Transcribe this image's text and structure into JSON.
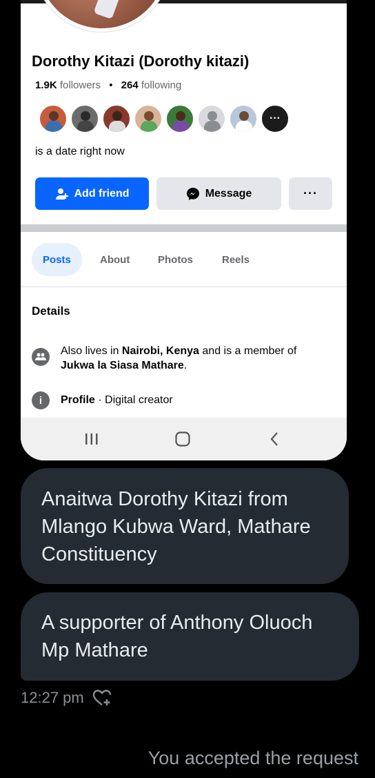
{
  "profile": {
    "name": "Dorothy Kitazi (Dorothy kitazi)",
    "followers_count": "1.9K",
    "followers_label": "followers",
    "following_count": "264",
    "following_label": "following",
    "bio": "is a date right now",
    "more_friends_glyph": "···"
  },
  "actions": {
    "add_friend": "Add friend",
    "message": "Message",
    "more": "···"
  },
  "tabs": [
    {
      "label": "Posts",
      "active": true
    },
    {
      "label": "About",
      "active": false
    },
    {
      "label": "Photos",
      "active": false
    },
    {
      "label": "Reels",
      "active": false
    }
  ],
  "details": {
    "title": "Details",
    "lives_prefix": "Also lives in ",
    "lives_place": "Nairobi, Kenya",
    "lives_middle": " and is a member of",
    "group_name": "Jukwa la Siasa Mathare",
    "group_suffix": ".",
    "profile_label": "Profile",
    "profile_sep": " · ",
    "profile_value": "Digital creator"
  },
  "chat": {
    "bubble1": "Anaitwa Dorothy Kitazi from Mlango Kubwa Ward, Mathare Constituency",
    "bubble2": "A supporter of Anthony Oluoch Mp Mathare",
    "time": "12:27 pm",
    "accepted": "You accepted the request"
  },
  "colors": {
    "fb_blue": "#0866ff",
    "bubble_bg": "#252b33",
    "page_bg": "#000000"
  },
  "icons": {
    "add_friend": "person-plus-icon",
    "message": "messenger-icon",
    "group": "group-icon",
    "info": "info-icon",
    "nav_recents": "recents-icon",
    "nav_home": "home-icon",
    "nav_back": "back-icon",
    "react": "heart-plus-icon"
  }
}
